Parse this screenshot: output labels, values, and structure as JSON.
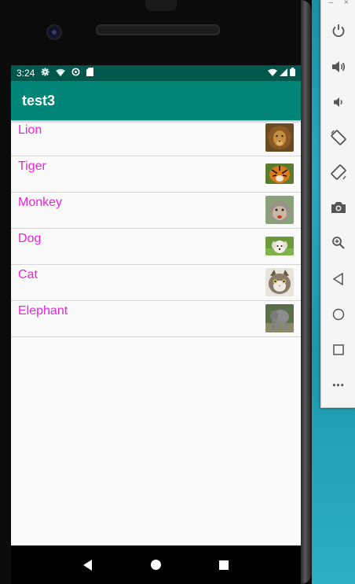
{
  "status_bar": {
    "time": "3:24"
  },
  "app": {
    "title": "test3"
  },
  "animals": [
    {
      "label": "Lion",
      "thumb_icon": "lion-photo-icon"
    },
    {
      "label": "Tiger",
      "thumb_icon": "tiger-photo-icon"
    },
    {
      "label": "Monkey",
      "thumb_icon": "monkey-photo-icon"
    },
    {
      "label": "Dog",
      "thumb_icon": "dog-photo-icon"
    },
    {
      "label": "Cat",
      "thumb_icon": "cat-photo-icon"
    },
    {
      "label": "Elephant",
      "thumb_icon": "elephant-photo-icon"
    }
  ],
  "emulator_panel": {
    "minimize_label": "–",
    "close_label": "×",
    "more_label": "•••",
    "buttons": [
      "power-icon",
      "volume-up-icon",
      "volume-down-icon",
      "rotate-left-icon",
      "rotate-right-icon",
      "camera-icon",
      "zoom-icon",
      "back-icon",
      "home-icon",
      "overview-icon",
      "more-icon"
    ]
  },
  "colors": {
    "status_bar": "#00574b",
    "app_bar": "#008577",
    "label_text": "#ee22dd",
    "list_bg": "#fafafa"
  }
}
